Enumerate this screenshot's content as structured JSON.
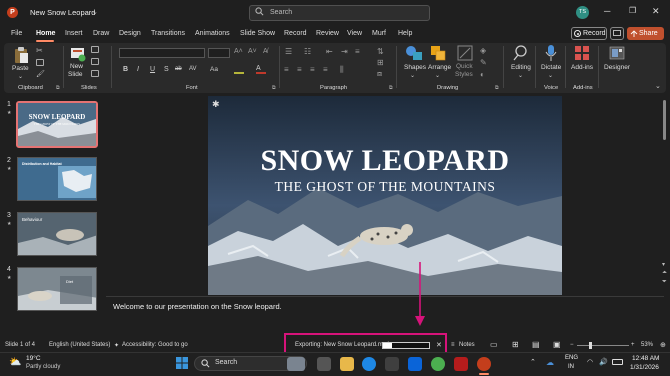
{
  "app": {
    "icon_letter": "P",
    "doc_title": "New Snow Leopard",
    "search_placeholder": "Search",
    "avatar_initials": "TS"
  },
  "menu": [
    "File",
    "Home",
    "Insert",
    "Draw",
    "Design",
    "Transitions",
    "Animations",
    "Slide Show",
    "Record",
    "Review",
    "View",
    "Murf",
    "Help"
  ],
  "top_buttons": {
    "record": "Record",
    "share": "Share"
  },
  "ribbon": {
    "paste": "Paste",
    "new_slide": [
      "New",
      "Slide"
    ],
    "shapes": "Shapes",
    "arrange": "Arrange",
    "quick_styles": [
      "Quick",
      "Styles"
    ],
    "editing": "Editing",
    "dictate": "Dictate",
    "addins": "Add-ins",
    "designer": "Designer",
    "font_format_buttons": [
      "B",
      "I",
      "U",
      "S",
      "ab",
      "AV",
      "Aa"
    ],
    "groups": [
      "Clipboard",
      "Slides",
      "Font",
      "Paragraph",
      "Drawing",
      "Voice",
      "Add-ins"
    ]
  },
  "thumbnails": [
    {
      "num": "1",
      "title": "SNOW LEOPARD",
      "subtitle": "THE GHOST OF THE MOUNTAINS"
    },
    {
      "num": "2",
      "title": "Distribution and Habitat"
    },
    {
      "num": "3",
      "title": "Behaviour"
    },
    {
      "num": "4",
      "title": "Diet"
    }
  ],
  "slide": {
    "title": "SNOW LEOPARD",
    "subtitle": "THE GHOST OF THE MOUNTAINS"
  },
  "notes": "Welcome to our presentation on the Snow leopard.",
  "status": {
    "slide_of": "Slide 1 of 4",
    "language": "English (United States)",
    "accessibility": "Accessibility: Good to go",
    "export_text": "Exporting: New Snow Leopard.mp4",
    "export_progress": 0.2,
    "notes_label": "Notes",
    "zoom": "53%"
  },
  "taskbar": {
    "temperature": "19°C",
    "weather": "Partly cloudy",
    "search": "Search",
    "lang": "ENG",
    "region": "IN",
    "time": "12:48 AM",
    "date": "1/31/2026"
  },
  "colors": {
    "accent": "#ff8a65",
    "highlight": "#d6137a",
    "share": "#c0502e"
  }
}
